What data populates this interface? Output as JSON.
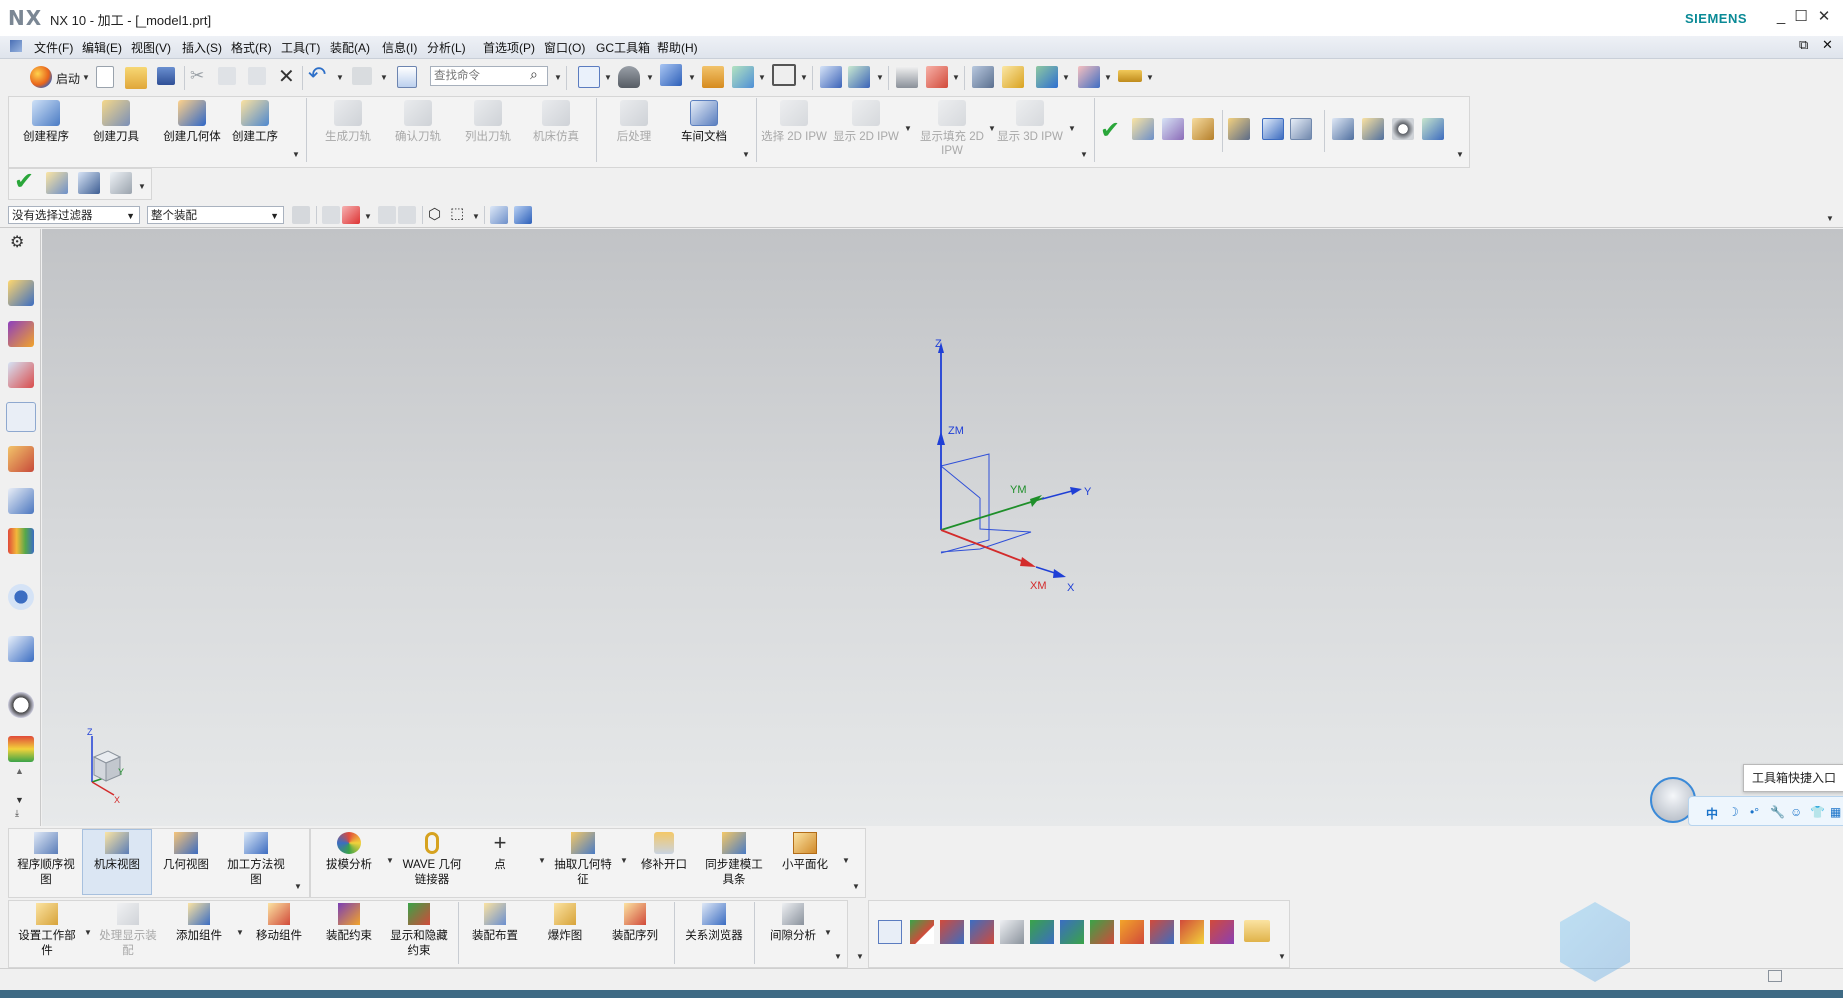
{
  "titlebar": {
    "logo": "NX",
    "title": "NX 10 - 加工 - [_model1.prt]",
    "brand": "SIEMENS",
    "minimize": "_",
    "maximize": "☐",
    "close": "✕"
  },
  "menubar": {
    "items": [
      "文件(F)",
      "编辑(E)",
      "视图(V)",
      "插入(S)",
      "格式(R)",
      "工具(T)",
      "装配(A)",
      "信息(I)",
      "分析(L)",
      "首选项(P)",
      "窗口(O)",
      "GC工具箱",
      "帮助(H)"
    ],
    "restore": "⧉",
    "close": "✕"
  },
  "standard_toolbar": {
    "start_label": "启动",
    "search_placeholder": "查找命令"
  },
  "manufacturing_toolbar": {
    "create": [
      "创建程序",
      "创建刀具",
      "创建几何体",
      "创建工序"
    ],
    "operations": [
      "生成刀轨",
      "确认刀轨",
      "列出刀轨",
      "机床仿真",
      "后处理",
      "车间文档"
    ],
    "ipw": [
      "选择 2D IPW",
      "显示 2D IPW",
      "显示填充 2D IPW",
      "显示 3D IPW"
    ]
  },
  "filter_bar": {
    "selection_filter": "没有选择过滤器",
    "assembly_scope": "整个装配"
  },
  "viewport": {
    "axis_labels": {
      "z": "Z",
      "zm": "ZM",
      "y": "Y",
      "ym": "YM",
      "x": "X",
      "xm": "XM"
    },
    "triad_labels": {
      "z": "Z",
      "y": "Y",
      "x": "X"
    }
  },
  "bottom_toolbar_1": {
    "views": [
      "程序顺序视图",
      "机床视图",
      "几何视图",
      "加工方法视图"
    ],
    "tools": [
      "拔模分析",
      "WAVE 几何链接器",
      "点",
      "抽取几何特征",
      "修补开口",
      "同步建模工具条",
      "小平面化"
    ]
  },
  "bottom_toolbar_2": {
    "assembly": [
      "设置工作部件",
      "处理显示装配",
      "添加组件",
      "移动组件",
      "装配约束",
      "显示和隐藏约束",
      "装配布置",
      "爆炸图",
      "装配序列",
      "关系浏览器",
      "间隙分析"
    ]
  },
  "gc_toolbox": {
    "tooltip": "工具箱快捷入口",
    "tray": [
      "中",
      "☽",
      "•°",
      "🔧",
      "☺",
      "👕",
      "▦"
    ]
  },
  "colors": {
    "brand": "#0a8a96",
    "axis_z": "#1f3fd6",
    "axis_y": "#1f8f2a",
    "axis_x": "#d32b2b",
    "viewport_top": "#c1c3c6",
    "viewport_bottom": "#e7e9ea"
  }
}
